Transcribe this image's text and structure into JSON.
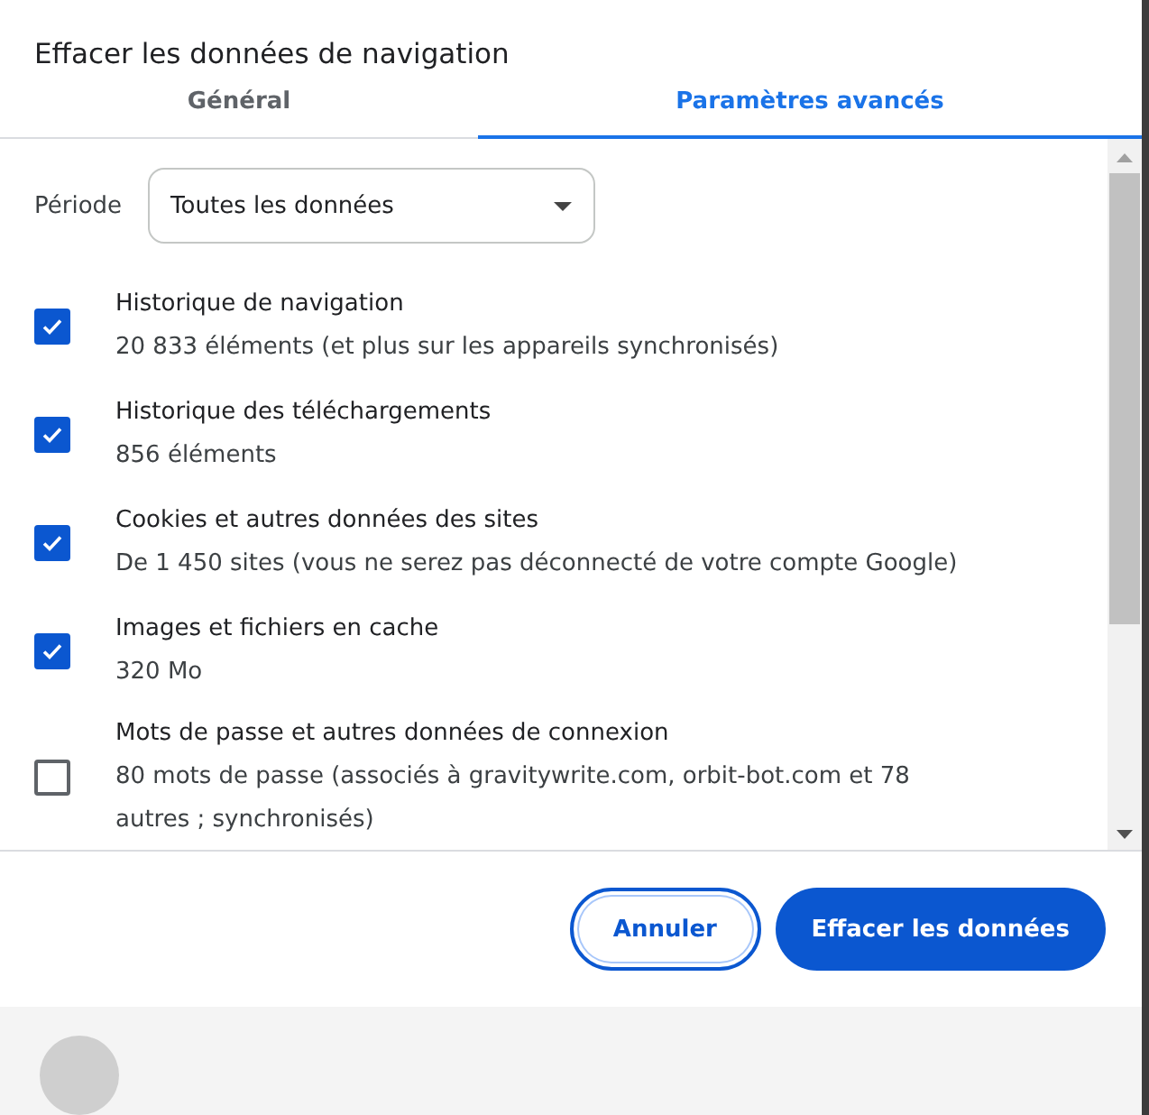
{
  "dialog": {
    "title": "Effacer les données de navigation"
  },
  "tabs": [
    {
      "label": "Général",
      "selected": false
    },
    {
      "label": "Paramètres avancés",
      "selected": true
    }
  ],
  "period": {
    "label": "Période",
    "value": "Toutes les données"
  },
  "items": [
    {
      "title": "Historique de navigation",
      "detail": "20 833 éléments (et plus sur les appareils synchronisés)",
      "checked": true
    },
    {
      "title": "Historique des téléchargements",
      "detail": "856 éléments",
      "checked": true
    },
    {
      "title": "Cookies et autres données des sites",
      "detail": "De 1 450 sites (vous ne serez pas déconnecté de votre compte Google)",
      "checked": true
    },
    {
      "title": "Images et fichiers en cache",
      "detail": "320 Mo",
      "checked": true
    },
    {
      "title": "Mots de passe et autres données de connexion",
      "detail": "80 mots de passe (associés à gravitywrite.com, orbit-bot.com et 78 autres ; synchronisés)",
      "checked": false
    }
  ],
  "buttons": {
    "cancel": "Annuler",
    "confirm": "Effacer les données"
  }
}
